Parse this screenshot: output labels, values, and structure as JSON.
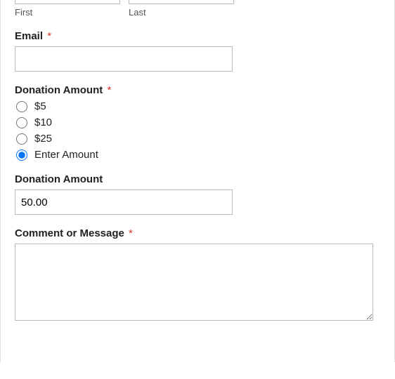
{
  "name": {
    "first_sublabel": "First",
    "last_sublabel": "Last",
    "first_value": "",
    "last_value": ""
  },
  "email": {
    "label": "Email",
    "required": "*",
    "value": ""
  },
  "donation": {
    "label": "Donation Amount",
    "required": "*",
    "options": [
      {
        "label": "$5",
        "checked": false
      },
      {
        "label": "$10",
        "checked": false
      },
      {
        "label": "$25",
        "checked": false
      },
      {
        "label": "Enter Amount",
        "checked": true
      }
    ]
  },
  "donation_custom": {
    "label": "Donation Amount",
    "value": "50.00"
  },
  "comment": {
    "label": "Comment or Message",
    "required": "*",
    "value": ""
  }
}
